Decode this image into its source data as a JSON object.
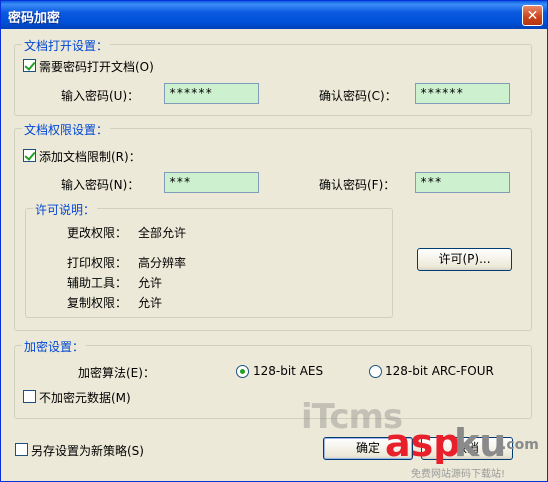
{
  "window": {
    "title": "密码加密",
    "close_symbol": "✕"
  },
  "open_group": {
    "title": "文档打开设置：",
    "require_password_label": "需要密码打开文档(O)",
    "require_password_checked": true,
    "input_label": "输入密码(U)：",
    "input_value": "******",
    "confirm_label": "确认密码(C)：",
    "confirm_value": "******"
  },
  "perm_group": {
    "title": "文档权限设置：",
    "add_restriction_label": "添加文档限制(R)：",
    "add_restriction_checked": true,
    "input_label": "输入密码(N)：",
    "input_value": "***",
    "confirm_label": "确认密码(F)：",
    "confirm_value": "***",
    "permission_desc": {
      "title": "许可说明：",
      "change_label": "更改权限：",
      "change_value": "全部允许",
      "print_label": "打印权限：",
      "print_value": "高分辨率",
      "aux_label": "辅助工具：",
      "aux_value": "允许",
      "copy_label": "复制权限：",
      "copy_value": "允许"
    },
    "permission_button": "许可(P)..."
  },
  "encrypt_group": {
    "title": "加密设置：",
    "algorithm_label": "加密算法(E)：",
    "aes_option": "128-bit AES",
    "arc_option": "128-bit ARC-FOUR",
    "selected": "128-bit AES",
    "no_metadata_label": "不加密元数据(M)",
    "no_metadata_checked": false
  },
  "footer": {
    "save_policy_label": "另存设置为新策略(S)",
    "save_policy_checked": false,
    "ok_button": "确定",
    "cancel_button": "取消"
  },
  "watermark": {
    "text1": "iTcms",
    "text2": "asp",
    "text3": "ku",
    "text4": ".com",
    "subtext": "免费网站源码下载站!"
  },
  "colors": {
    "field_bg": "#cdf0cf",
    "group_title": "#0046d5",
    "titlebar": "#0054e3"
  }
}
